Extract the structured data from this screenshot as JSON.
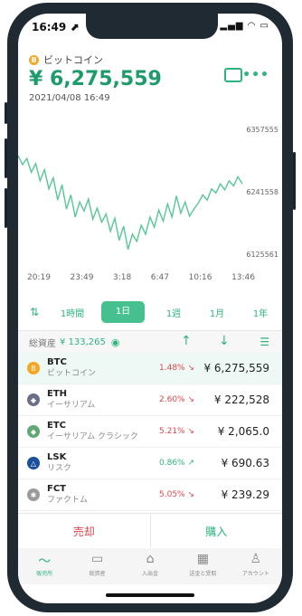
{
  "status_bar": {
    "time": "16:49 ⬈",
    "icons": "▂▄▆ ◠ ▭"
  },
  "coin": {
    "symbol_glyph": "B",
    "name": "ビットコイン",
    "price": "¥ 6,275,559",
    "datetime": "2021/04/08 16:49"
  },
  "chart_data": {
    "type": "line",
    "y_ticks": [
      "6357555",
      "6241558",
      "6125561"
    ],
    "x_ticks": [
      "20:19",
      "23:49",
      "3:18",
      "6:47",
      "10:16",
      "13:46"
    ],
    "ylim": [
      6110000,
      6370000
    ],
    "color": "#56c795",
    "values": [
      6318000,
      6300000,
      6312000,
      6285000,
      6302000,
      6268000,
      6290000,
      6252000,
      6274000,
      6230000,
      6260000,
      6212000,
      6240000,
      6196000,
      6226000,
      6208000,
      6232000,
      6192000,
      6214000,
      6186000,
      6202000,
      6168000,
      6194000,
      6150000,
      6178000,
      6132000,
      6162000,
      6148000,
      6180000,
      6162000,
      6196000,
      6176000,
      6210000,
      6188000,
      6222000,
      6196000,
      6238000,
      6204000,
      6226000,
      6198000,
      6212000,
      6224000,
      6240000,
      6230000,
      6252000,
      6244000,
      6262000,
      6250000,
      6268000,
      6258000,
      6276000,
      6262000
    ]
  },
  "timeframes": [
    "1時間",
    "1日",
    "1週",
    "1月",
    "1年"
  ],
  "assets": {
    "label": "総資産",
    "value": "¥ 133,265"
  },
  "coins": [
    {
      "symbol": "BTC",
      "name": "ビットコイン",
      "change": "1.48% ↘",
      "price": "¥ 6,275,559",
      "icon_color": "#f5a623",
      "icon_glyph": "B"
    },
    {
      "symbol": "ETH",
      "name": "イーサリアム",
      "change": "2.60% ↘",
      "price": "¥ 222,528",
      "icon_color": "#6a6f8c",
      "icon_glyph": "◆"
    },
    {
      "symbol": "ETC",
      "name": "イーサリアム クラシック",
      "change": "5.21% ↘",
      "price": "¥ 2,065.0",
      "icon_color": "#5fa876",
      "icon_glyph": "◆"
    },
    {
      "symbol": "LSK",
      "name": "リスク",
      "change": "0.86% ↗",
      "price": "¥ 690.63",
      "icon_color": "#1a4f9c",
      "icon_glyph": "△"
    },
    {
      "symbol": "FCT",
      "name": "ファクトム",
      "change": "5.05% ↘",
      "price": "¥ 239.29",
      "icon_color": "#9a9a9a",
      "icon_glyph": "✱"
    }
  ],
  "colors": {
    "down": "#e0454a",
    "up": "#2fb37f"
  },
  "trade": {
    "sell": "売却",
    "buy": "購入"
  },
  "tabs": [
    {
      "label": "販売所",
      "icon": "chart-icon"
    },
    {
      "label": "総資産",
      "icon": "wallet-icon"
    },
    {
      "label": "入出金",
      "icon": "bank-icon"
    },
    {
      "label": "送金と受取",
      "icon": "qr-icon"
    },
    {
      "label": "アカウント",
      "icon": "user-icon"
    }
  ]
}
